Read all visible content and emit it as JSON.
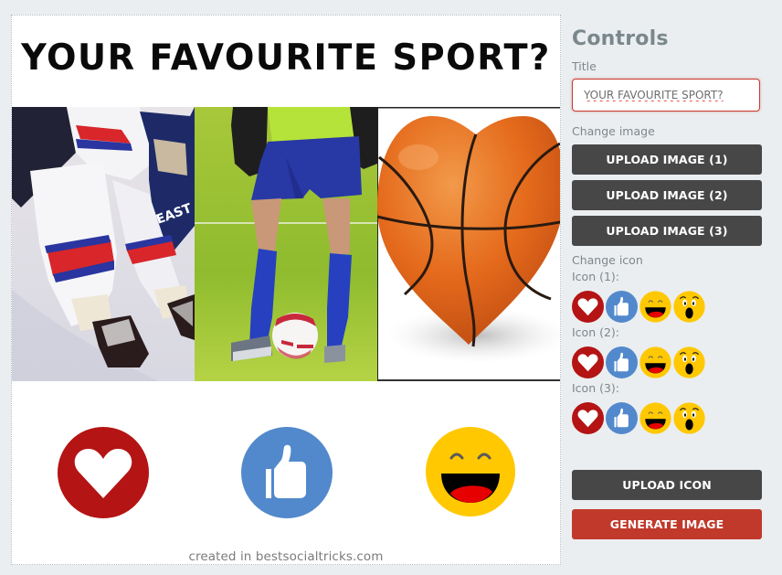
{
  "canvas": {
    "title": "YOUR FAVOURITE SPORT?",
    "images": [
      {
        "name": "ice-hockey-image",
        "alt": "Ice hockey player skating"
      },
      {
        "name": "soccer-image",
        "alt": "Soccer player with ball"
      },
      {
        "name": "basketball-heart-image",
        "alt": "Heart-shaped basketball"
      }
    ],
    "reactions": [
      {
        "icon": "heart-icon",
        "color": "#b41414"
      },
      {
        "icon": "thumbs-up-icon",
        "color": "#5289cc"
      },
      {
        "icon": "laughing-face-icon",
        "color": "#ffc800"
      }
    ],
    "credit": "created in bestsocialtricks.com"
  },
  "controls": {
    "heading": "Controls",
    "title_label": "Title",
    "title_value": "YOUR FAVOURITE SPORT?",
    "change_image_label": "Change image",
    "upload_image_buttons": [
      "UPLOAD IMAGE (1)",
      "UPLOAD IMAGE (2)",
      "UPLOAD IMAGE (3)"
    ],
    "change_icon_label": "Change icon",
    "icon_groups": [
      {
        "label": "Icon (1):",
        "selected": "heart-icon"
      },
      {
        "label": "Icon (2):",
        "selected": "thumbs-up-icon"
      },
      {
        "label": "Icon (3):",
        "selected": "laughing-face-icon"
      }
    ],
    "icon_options": [
      "heart-icon",
      "thumbs-up-icon",
      "laughing-face-icon",
      "surprised-face-icon"
    ],
    "upload_icon_label": "UPLOAD ICON",
    "generate_label": "GENERATE IMAGE"
  },
  "colors": {
    "heart": "#b41414",
    "like": "#5289cc",
    "emoji": "#ffc800",
    "dark_button": "#474747",
    "accent_red": "#c0392b",
    "page_bg": "#ebeef0"
  }
}
